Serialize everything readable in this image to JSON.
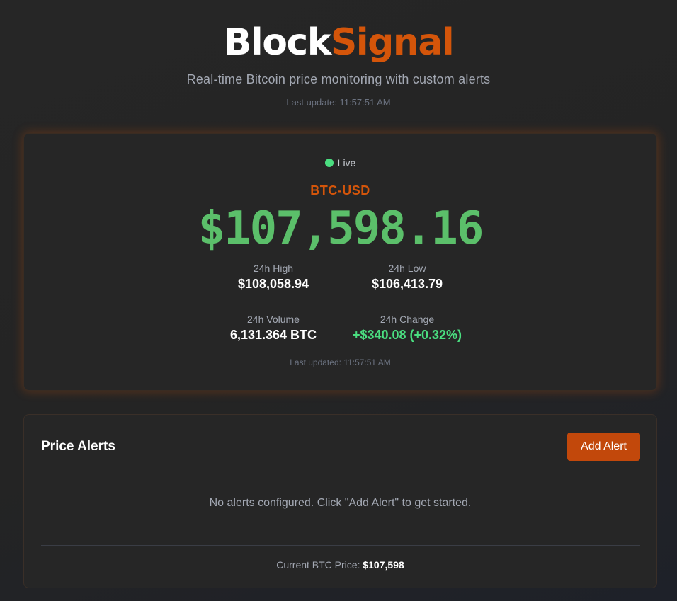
{
  "header": {
    "brand_part1": "Block",
    "brand_part2": "Signal",
    "tagline": "Real-time Bitcoin price monitoring with custom alerts",
    "last_update": "Last update: 11:57:51 AM"
  },
  "ticker": {
    "status": "Live",
    "pair": "BTC-USD",
    "price": "$107,598.16",
    "stats": {
      "high_label": "24h High",
      "high_value": "$108,058.94",
      "low_label": "24h Low",
      "low_value": "$106,413.79",
      "volume_label": "24h Volume",
      "volume_value": "6,131.364 BTC",
      "change_label": "24h Change",
      "change_value": "+$340.08 (+0.32%)"
    },
    "last_updated": "Last updated: 11:57:51 AM"
  },
  "alerts": {
    "title": "Price Alerts",
    "add_button": "Add Alert",
    "empty_message": "No alerts configured. Click \"Add Alert\" to get started.",
    "current_price_label": "Current BTC Price:",
    "current_price_value": "$107,598"
  },
  "colors": {
    "accent": "#d4550a",
    "price_green": "#5bbf6a",
    "positive": "#4ade80",
    "background": "#262626"
  },
  "icons": {
    "live_indicator": "green-dot-icon"
  }
}
